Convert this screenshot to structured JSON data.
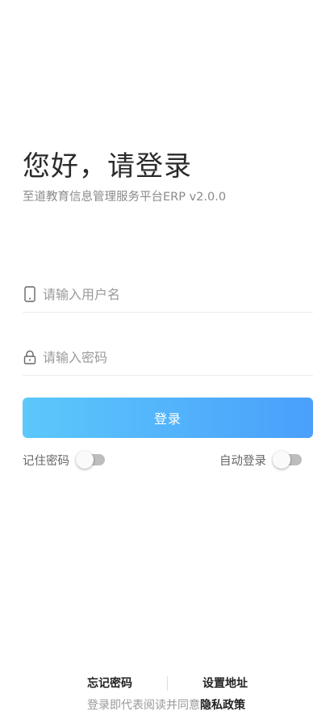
{
  "header": {
    "title": "您好，请登录",
    "subtitle": "至道教育信息管理服务平台ERP v2.0.0"
  },
  "form": {
    "username_placeholder": "请输入用户名",
    "username_value": "",
    "username_icon": "phone-icon",
    "password_placeholder": "请输入密码",
    "password_value": "",
    "password_icon": "lock-icon",
    "login_label": "登录"
  },
  "options": {
    "remember_label": "记住密码",
    "remember_on": false,
    "auto_login_label": "自动登录",
    "auto_login_on": false
  },
  "footer": {
    "forgot_label": "忘记密码",
    "set_address_label": "设置地址",
    "agreement_text": "登录即代表阅读并同意",
    "privacy_label": "隐私政策"
  },
  "colors": {
    "button_gradient_start": "#5cc8fb",
    "button_gradient_end": "#4a9ffb",
    "switch_track": "#bdbdbd"
  }
}
